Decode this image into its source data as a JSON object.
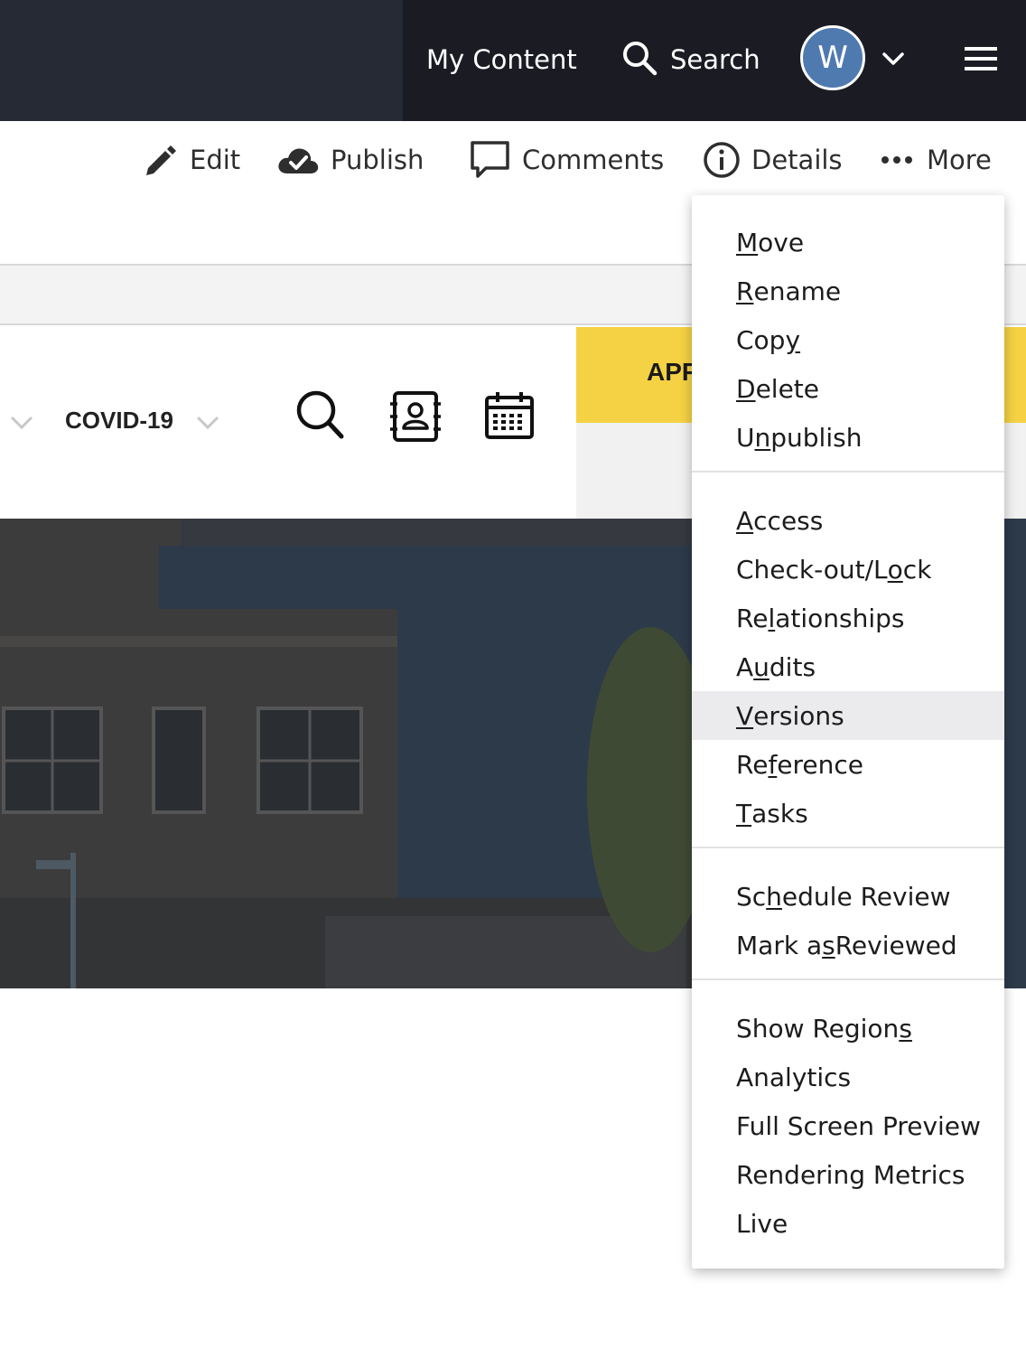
{
  "topbar": {
    "my_content": "My Content",
    "search": "Search",
    "avatar_initial": "W"
  },
  "toolbar": {
    "edit": "Edit",
    "publish": "Publish",
    "comments": "Comments",
    "details": "Details",
    "more": "More"
  },
  "nav": {
    "covid": "COVID-19",
    "tab_text": "APP"
  },
  "menu": {
    "groups": [
      [
        {
          "pre": "",
          "u": "M",
          "post": "ove"
        },
        {
          "pre": "",
          "u": "R",
          "post": "ename"
        },
        {
          "pre": "Cop",
          "u": "y",
          "post": ""
        },
        {
          "pre": "",
          "u": "D",
          "post": "elete"
        },
        {
          "pre": "U",
          "u": "n",
          "post": "publish"
        }
      ],
      [
        {
          "pre": "",
          "u": "A",
          "post": "ccess"
        },
        {
          "pre": "Check-out/L",
          "u": "o",
          "post": "ck"
        },
        {
          "pre": "Re",
          "u": "l",
          "post": "ationships"
        },
        {
          "pre": "A",
          "u": "u",
          "post": "dits"
        },
        {
          "pre": "",
          "u": "V",
          "post": "ersions",
          "active": true
        },
        {
          "pre": "Re",
          "u": "f",
          "post": "erence"
        },
        {
          "pre": "",
          "u": "T",
          "post": "asks"
        }
      ],
      [
        {
          "pre": "Sc",
          "u": "h",
          "post": "edule Review"
        },
        {
          "pre": "Mark a",
          "u": "s",
          "post": " Reviewed"
        }
      ],
      [
        {
          "pre": "Show Region",
          "u": "s",
          "post": ""
        },
        {
          "pre": "Analytics",
          "u": "",
          "post": ""
        },
        {
          "pre": "Full Screen Preview",
          "u": "",
          "post": ""
        },
        {
          "pre": "Rendering Metrics",
          "u": "",
          "post": ""
        },
        {
          "pre": "Live",
          "u": "",
          "post": ""
        }
      ]
    ]
  },
  "colors": {
    "topbar": "#1b1c23",
    "avatar": "#4f7ab0",
    "yellow": "#f5d243",
    "menu_active": "#ebebed"
  }
}
